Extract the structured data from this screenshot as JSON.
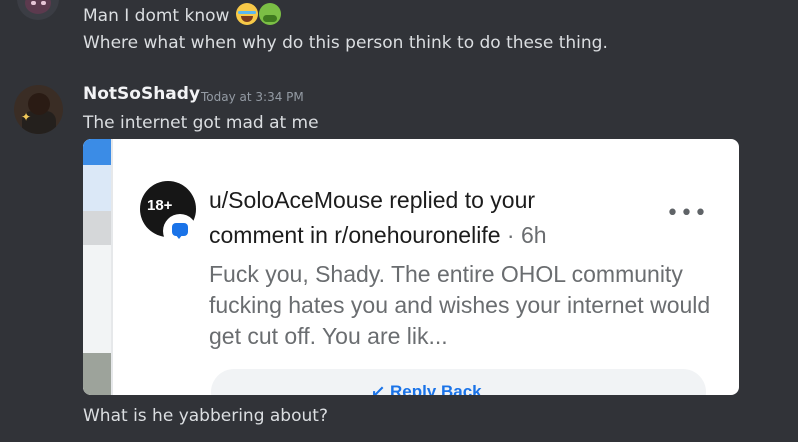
{
  "previous_message": {
    "line1": "Man I domt know",
    "line1_emojis": [
      "loudly-crying-face",
      "nauseated-face"
    ],
    "line2": "Where what when why do this person think to do these thing."
  },
  "message": {
    "username": "NotSoShady",
    "timestamp": "Today at 3:34 PM",
    "text": "The internet got mad at me",
    "attachment": {
      "avatar_badge": "18+",
      "title_part1": "u/SoloAceMouse replied to your",
      "title_part2": "comment in r/onehouronelife",
      "separator": "·",
      "age": "6h",
      "more_icon": "more-horizontal-icon",
      "body": "Fuck you, Shady. The entire OHOL community fucking hates you and wishes your internet would get cut off. You are lik...",
      "reply_button_label": "↙ Reply Back"
    }
  },
  "next_message": {
    "text": "What is he yabbering about?"
  },
  "colors": {
    "background": "#313338",
    "text": "#dbdee1",
    "username": "#f2f3f5",
    "timestamp": "#949ba4",
    "reddit_blue": "#1a73e8"
  }
}
